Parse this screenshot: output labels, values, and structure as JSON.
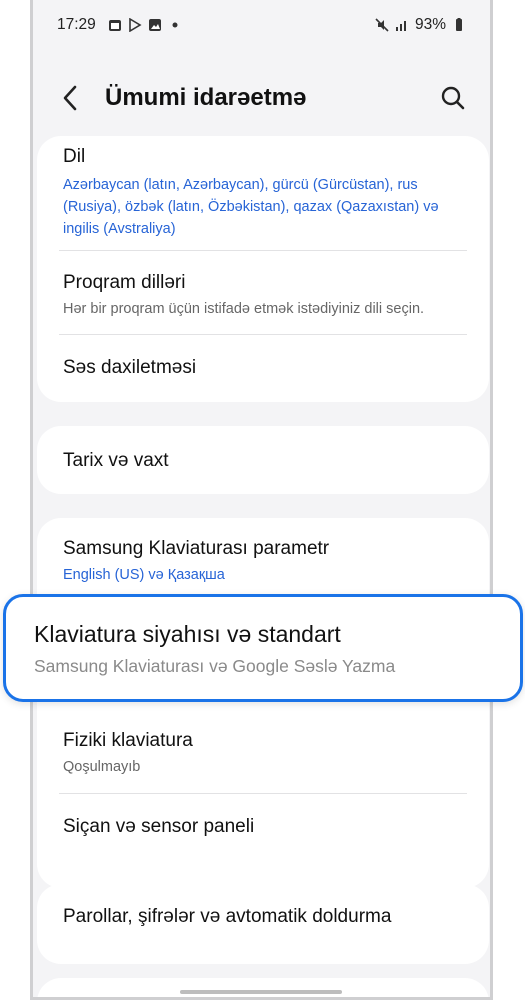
{
  "status": {
    "time": "17:29",
    "battery": "93%"
  },
  "header": {
    "title": "Ümumi idarəetmə"
  },
  "items": [
    {
      "label": "Dil",
      "sub": "Azərbaycan (latın, Azərbaycan), gürcü (Gürcüstan), rus (Rusiya), özbək (latın, Özbəkistan), qazax (Qazaxıstan) və ingilis (Avstraliya)"
    },
    {
      "label": "Proqram dilləri",
      "sub": "Hər bir proqram üçün istifadə etmək istədiyiniz dili seçin."
    },
    {
      "label": "Səs daxiletməsi"
    },
    {
      "label": "Tarix və vaxt"
    },
    {
      "label": "Samsung Klaviaturası parametr",
      "sub": "English (US) və Қазақша"
    },
    {
      "label": "Klaviatura siyahısı və standart",
      "sub": "Samsung Klaviaturası və Google Səslə Yazma"
    },
    {
      "label": "Fiziki klaviatura",
      "sub": "Qoşulmayıb"
    },
    {
      "label": "Siçan və sensor paneli"
    },
    {
      "label": "Parollar, şifrələr və avtomatik doldurma"
    }
  ],
  "colors": {
    "accent": "#1a73e8",
    "link": "#2764d6",
    "background": "#f4f4f6"
  }
}
